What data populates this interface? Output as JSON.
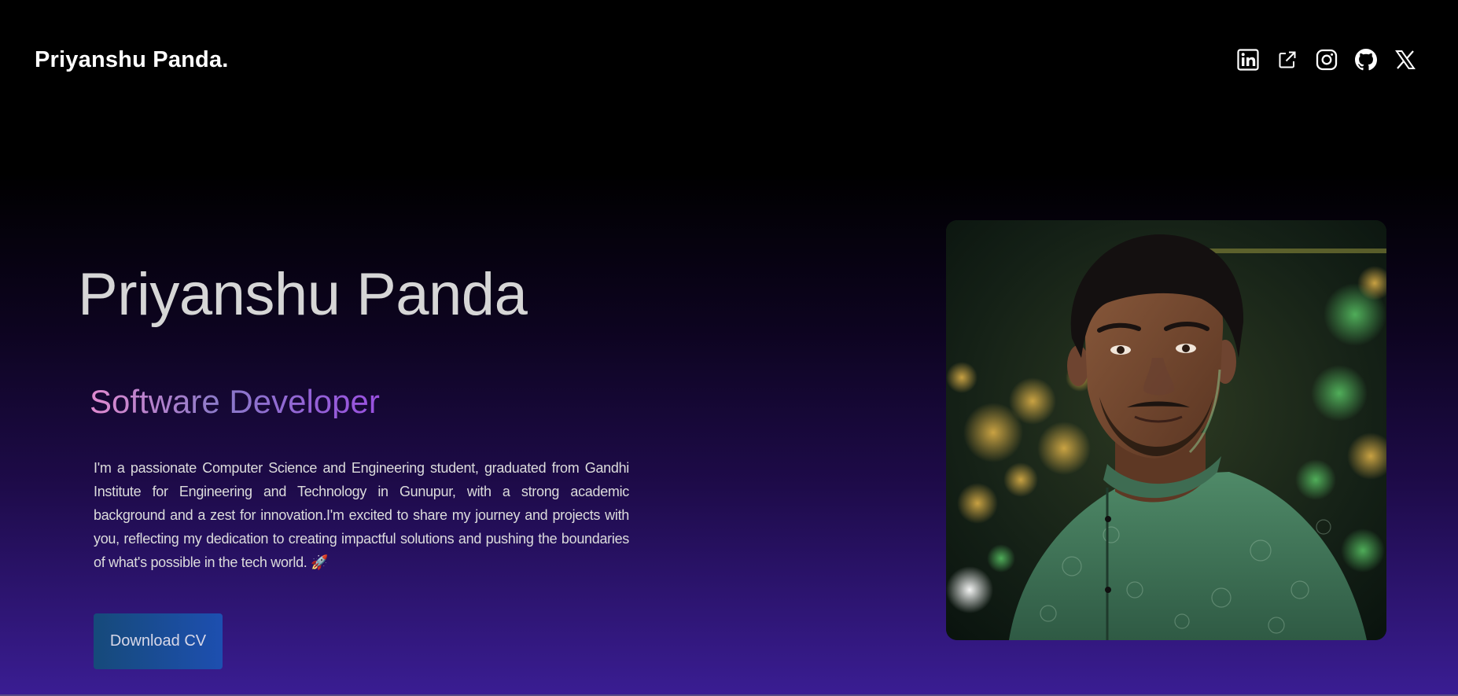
{
  "header": {
    "brand": "Priyanshu Panda.",
    "socials": [
      {
        "icon": "linkedin-icon"
      },
      {
        "icon": "external-link-icon"
      },
      {
        "icon": "instagram-icon"
      },
      {
        "icon": "github-icon"
      },
      {
        "icon": "x-twitter-icon"
      }
    ]
  },
  "hero": {
    "name": "Priyanshu Panda",
    "role": "Software Developer",
    "bio": "I'm a passionate Computer Science and Engineering student, graduated from Gandhi Institute for Engineering and Technology in Gunupur, with a strong academic background and a zest for innovation.I'm excited to share my journey and projects with you, reflecting my dedication to creating impactful solutions and pushing the boundaries of what's possible in the tech world. 🚀",
    "cv_button": "Download CV",
    "portrait_icon": "profile-photo"
  },
  "colors": {
    "background_top": "#000000",
    "background_bottom": "#3a1d93",
    "role_gradient_start": "#e08ad0",
    "role_gradient_end": "#9a50e0",
    "button_start": "#164a7a",
    "button_end": "#1d4fb0"
  }
}
